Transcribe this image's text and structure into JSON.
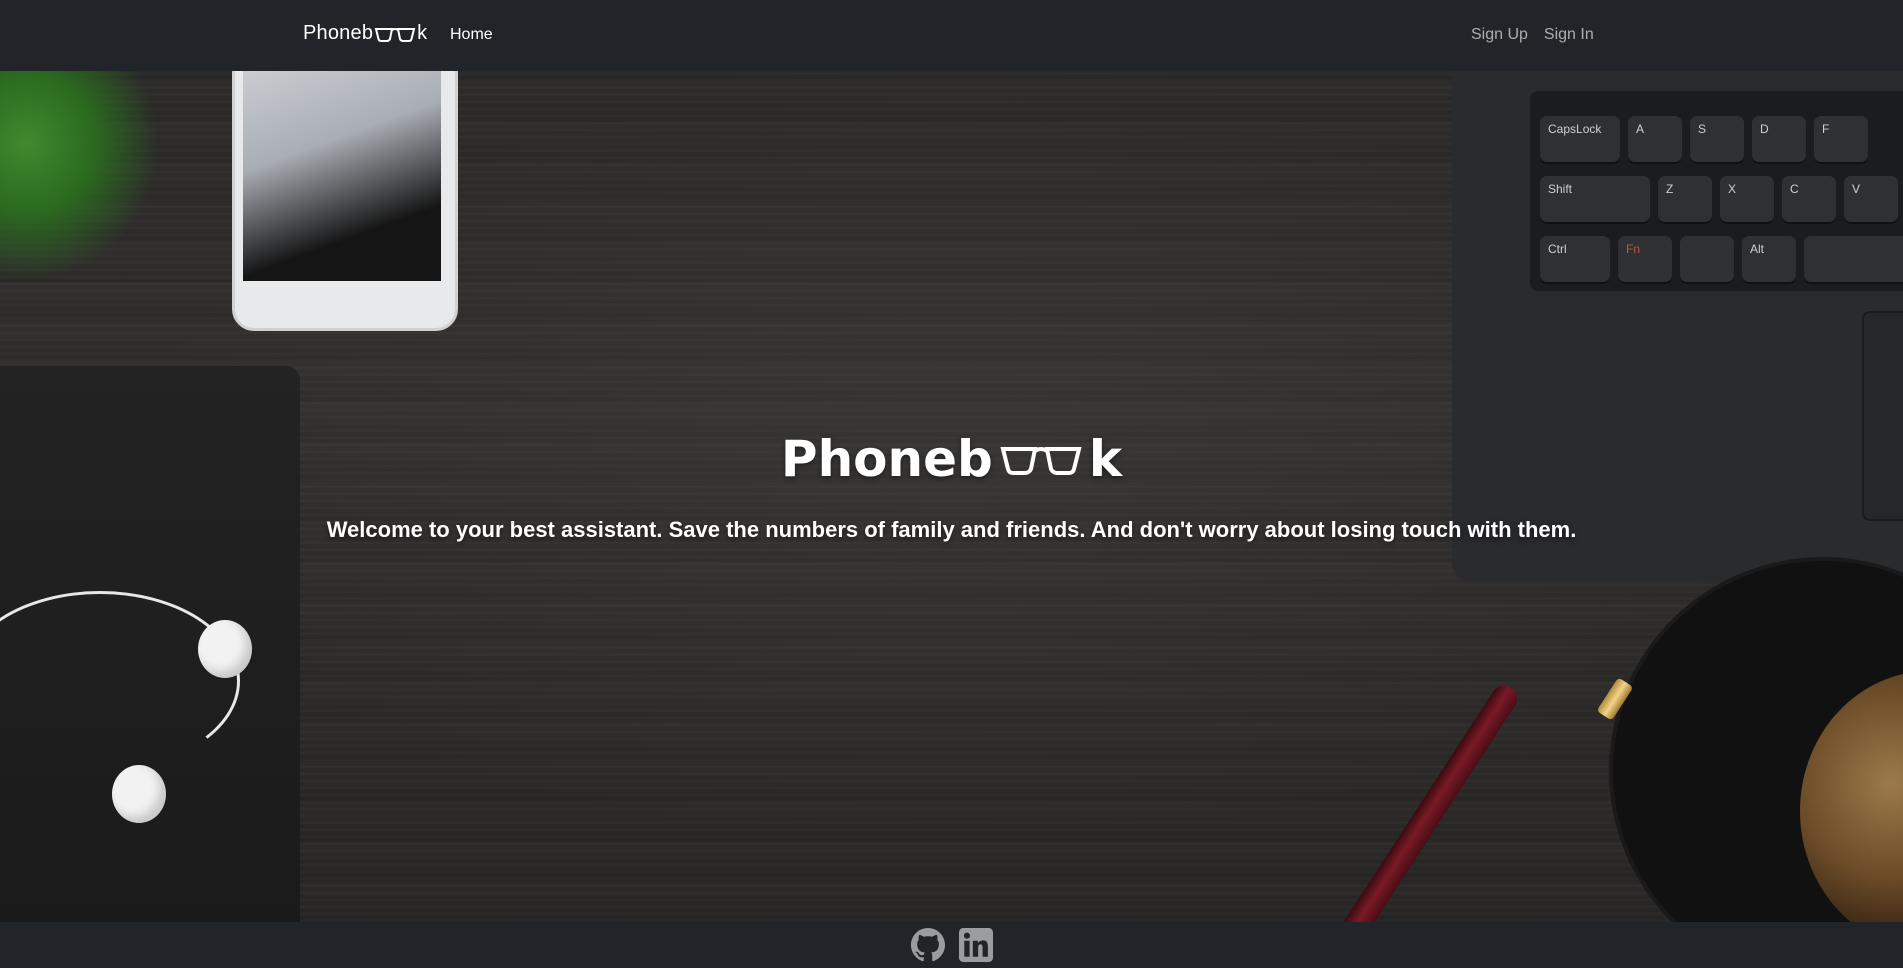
{
  "navbar": {
    "brand_prefix": "Phoneb",
    "brand_suffix": "k",
    "home_label": "Home",
    "signup_label": "Sign Up",
    "signin_label": "Sign In"
  },
  "hero": {
    "title_prefix": "Phoneb",
    "title_suffix": "k",
    "subtitle": "Welcome to your best assistant. Save the numbers of family and friends. And don't worry about losing touch with them.",
    "keyboard_keys": [
      "CapsLock",
      "A",
      "S",
      "D",
      "F",
      "Shift",
      "Z",
      "X",
      "C",
      "V",
      "Ctrl",
      "Fn",
      "Alt"
    ]
  },
  "footer": {
    "icons": [
      "github-icon",
      "linkedin-icon"
    ]
  },
  "colors": {
    "navbar_bg": "#212529",
    "nav_link_muted": "rgba(255,255,255,0.62)",
    "text": "#ffffff"
  }
}
